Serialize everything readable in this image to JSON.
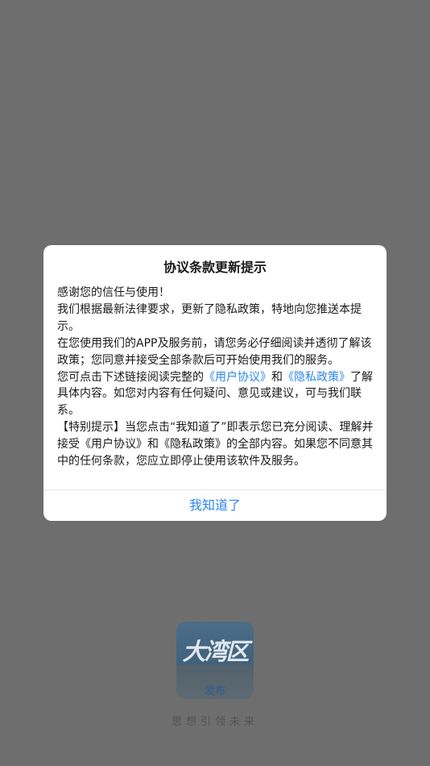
{
  "splash": {
    "logo_text": "大湾区",
    "logo_sub": "发布",
    "slogan": "思想引领未来"
  },
  "dialog": {
    "title": "协议条款更新提示",
    "p1": "感谢您的信任与使用！",
    "p2": "我们根据最新法律要求，更新了隐私政策，特地向您推送本提示。",
    "p3": "在您使用我们的APP及服务前，请您务必仔细阅读并透彻了解该政策；您同意并接受全部条款后可开始使用我们的服务。",
    "p4_before": "您可点击下述链接阅读完整的",
    "link_user_agreement": "《用户协议》",
    "p4_and": "和",
    "link_privacy_policy": "《隐私政策》",
    "p4_after": "了解具体内容。如您对内容有任何疑问、意见或建议，可与我们联系。",
    "p5": "【特别提示】当您点击“我知道了”即表示您已充分阅读、理解并接受《用户协议》和《隐私政策》的全部内容。如果您不同意其中的任何条款，您应立即停止使用该软件及服务。",
    "confirm_label": "我知道了"
  },
  "colors": {
    "overlay": "#6e6e6e",
    "link": "#2c86e8",
    "dialog_bg": "#ffffff"
  }
}
